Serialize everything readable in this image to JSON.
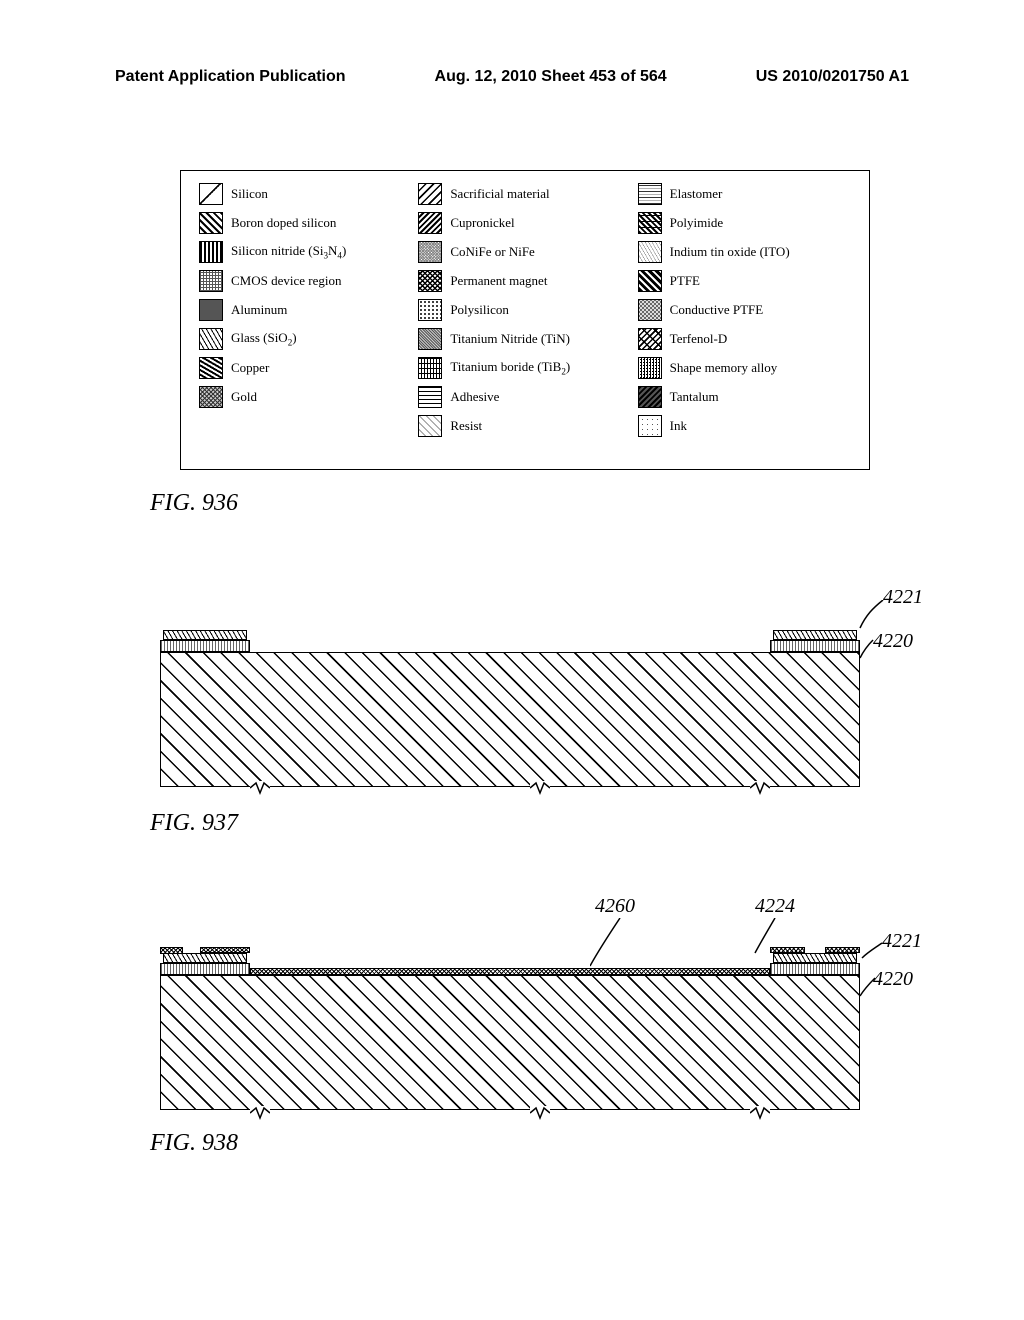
{
  "header": {
    "left": "Patent Application Publication",
    "middle": "Aug. 12, 2010  Sheet 453 of 564",
    "right": "US 2010/0201750 A1"
  },
  "legend": {
    "col1": [
      {
        "label": "Silicon"
      },
      {
        "label": "Boron doped silicon"
      },
      {
        "label_html": "Silicon nitride (Si<span class='sub'>3</span>N<span class='sub'>4</span>)"
      },
      {
        "label": "CMOS device region"
      },
      {
        "label": "Aluminum"
      },
      {
        "label_html": "Glass (SiO<span class='sub'>2</span>)"
      },
      {
        "label": "Copper"
      },
      {
        "label": "Gold"
      }
    ],
    "col2": [
      {
        "label": "Sacrificial material"
      },
      {
        "label": "Cupronickel"
      },
      {
        "label": "CoNiFe or NiFe"
      },
      {
        "label": "Permanent magnet"
      },
      {
        "label": "Polysilicon"
      },
      {
        "label": "Titanium Nitride (TiN)"
      },
      {
        "label_html": "Titanium boride (TiB<span class='sub'>2</span>)"
      },
      {
        "label": "Adhesive"
      },
      {
        "label": "Resist"
      }
    ],
    "col3": [
      {
        "label": "Elastomer"
      },
      {
        "label": "Polyimide"
      },
      {
        "label": "Indium tin oxide (ITO)"
      },
      {
        "label": "PTFE"
      },
      {
        "label": "Conductive PTFE"
      },
      {
        "label": "Terfenol-D"
      },
      {
        "label": "Shape memory alloy"
      },
      {
        "label": "Tantalum"
      },
      {
        "label": "Ink"
      }
    ]
  },
  "figures": {
    "fig936": "FIG. 936",
    "fig937": "FIG. 937",
    "fig938": "FIG. 938"
  },
  "refs": {
    "r4221_a": "4221",
    "r4220_a": "4220",
    "r4260": "4260",
    "r4224": "4224",
    "r4221_b": "4221",
    "r4220_b": "4220"
  }
}
